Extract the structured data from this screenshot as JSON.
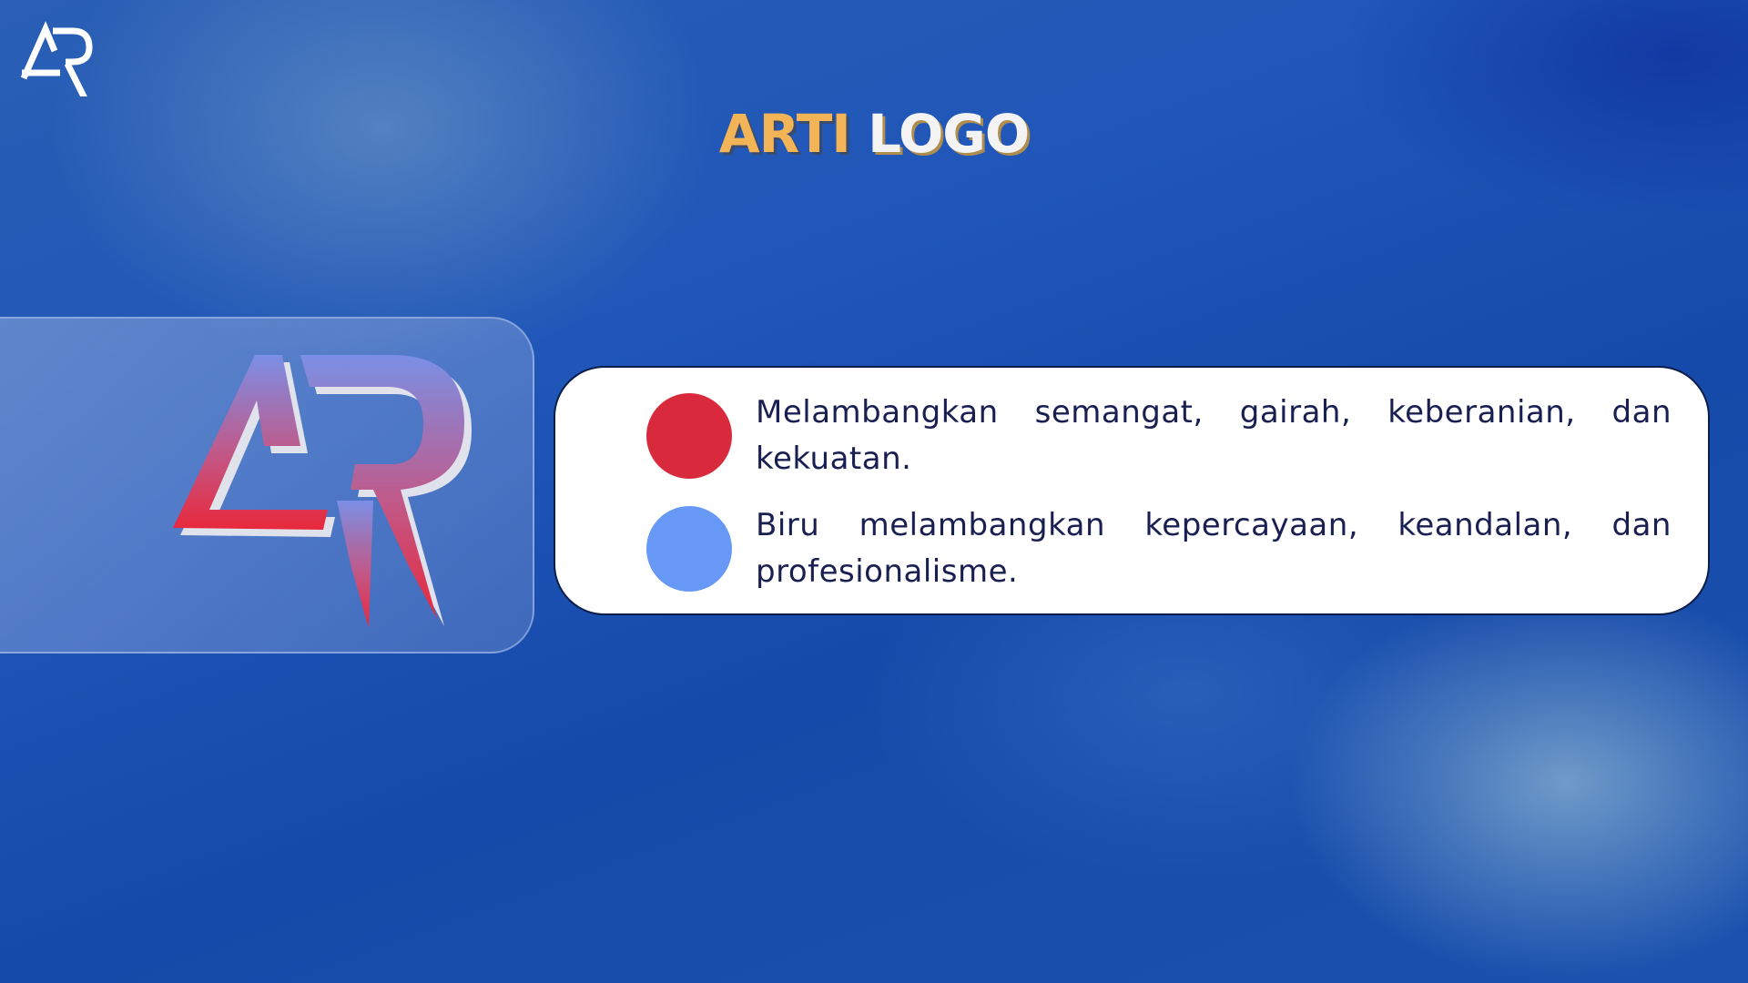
{
  "slide": {
    "title_part_1": "ARTI",
    "title_part_2": "LOGO",
    "brand_logo": "AR",
    "meanings": [
      {
        "color": "#d82a3c",
        "text": "Melambangkan semangat, gairah, keberanian, dan kekuatan."
      },
      {
        "color": "#6898f6",
        "text": "Biru melambangkan kepercayaan, keandalan, dan profesionalisme."
      }
    ]
  },
  "colors": {
    "background": "#1b52ae",
    "title_accent": "#f3b457",
    "title_white": "#f3f3f3",
    "text": "#1a1f52"
  },
  "icons": [
    "ar-logo-icon",
    "ar-logo-large-icon"
  ]
}
